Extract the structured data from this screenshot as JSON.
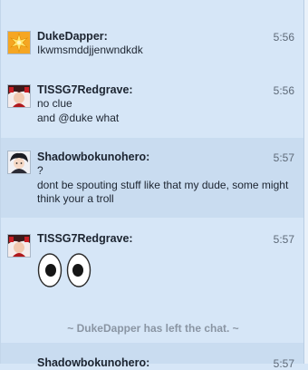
{
  "messages": [
    {
      "username": "DukeDapper:",
      "time": "5:56",
      "lines": [
        "Ikwmsmddjjenwndkdk"
      ],
      "avatar_icon": "star-burst-icon"
    },
    {
      "username": "TISSG7Redgrave:",
      "time": "5:56",
      "lines": [
        "no clue",
        "and @duke what"
      ],
      "avatar_icon": "character-portrait-icon"
    },
    {
      "username": "Shadowbokunohero:",
      "time": "5:57",
      "lines": [
        "?",
        "dont be spouting stuff like that my dude, some might think your a troll"
      ],
      "avatar_icon": "anime-portrait-icon"
    },
    {
      "username": "TISSG7Redgrave:",
      "time": "5:57",
      "emoji": "eyes-emoji",
      "avatar_icon": "character-portrait-icon"
    }
  ],
  "system_message": "~ DukeDapper has left the chat. ~",
  "partial_next": {
    "username": "Shadowbokunohero:",
    "time": "5:57"
  },
  "colors": {
    "background": "#d6e6f7",
    "alt_row": "#c9dcf0",
    "system_text": "#8a95a3"
  }
}
